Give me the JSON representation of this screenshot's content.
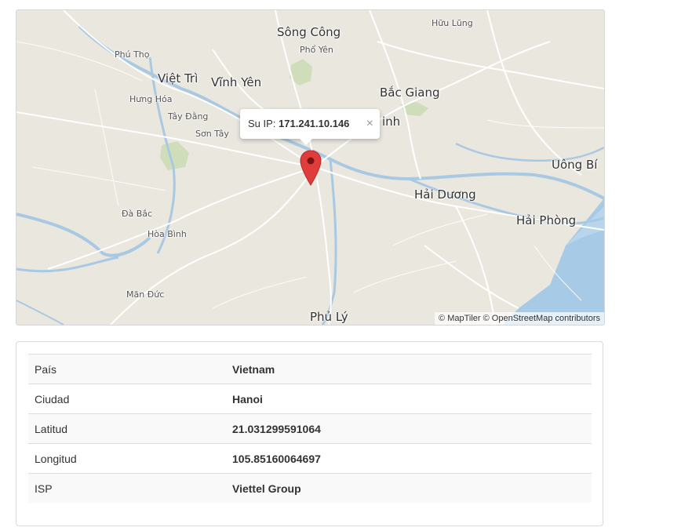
{
  "map": {
    "places_big": [
      {
        "name": "Sông Công"
      },
      {
        "name": "Việt Trì"
      },
      {
        "name": "Vĩnh Yên"
      },
      {
        "name": "Bắc Giang"
      },
      {
        "name": "Uông Bí"
      },
      {
        "name": "Hải Dương"
      },
      {
        "name": "Hải Phòng"
      },
      {
        "name": "Phủ Lý"
      },
      {
        "name": "inh"
      }
    ],
    "places_small": [
      {
        "name": "Hữu Lũng"
      },
      {
        "name": "Phú Thọ"
      },
      {
        "name": "Phổ Yên"
      },
      {
        "name": "Hưng Hóa"
      },
      {
        "name": "Tây Đằng"
      },
      {
        "name": "Sơn Tây"
      },
      {
        "name": "Đà Bắc"
      },
      {
        "name": "Hòa Bình"
      },
      {
        "name": "Mãn Đức"
      }
    ],
    "popup": {
      "prefix": "Su IP:",
      "ip": "171.241.10.146",
      "close": "×"
    },
    "attribution": "© MapTiler © OpenStreetMap contributors",
    "marker_color": "#e03c3c"
  },
  "info": {
    "rows": [
      {
        "label": "País",
        "value": "Vietnam"
      },
      {
        "label": "Ciudad",
        "value": "Hanoi"
      },
      {
        "label": "Latitud",
        "value": "21.031299591064"
      },
      {
        "label": "Longitud",
        "value": "105.85160064697"
      },
      {
        "label": "ISP",
        "value": "Viettel Group"
      }
    ]
  }
}
